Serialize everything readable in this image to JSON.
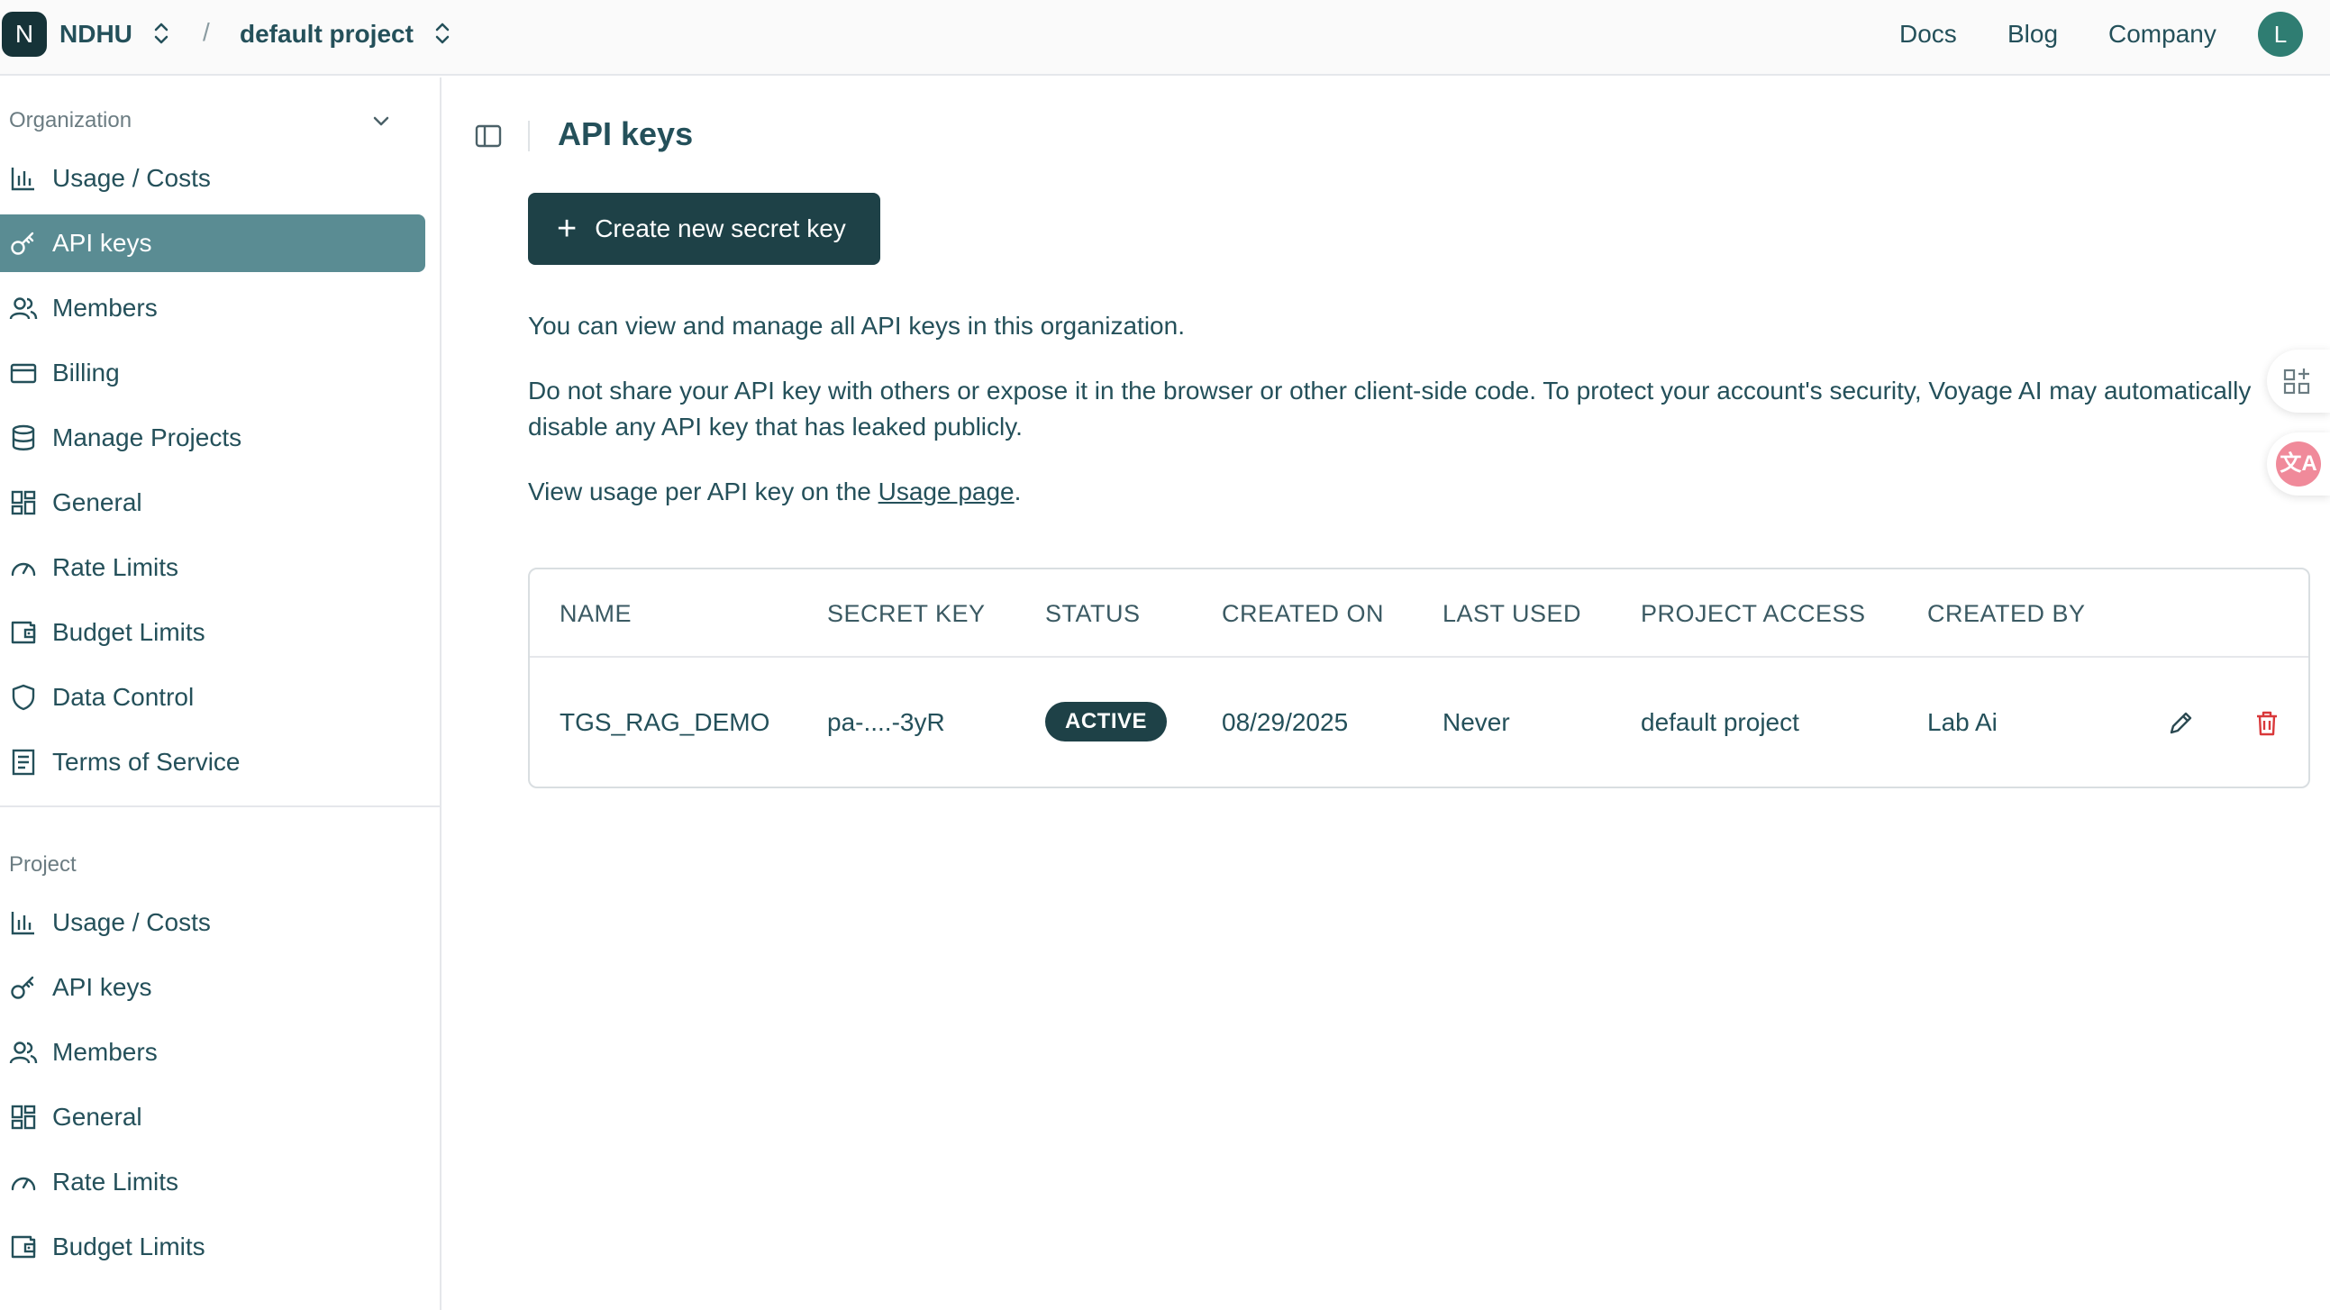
{
  "topbar": {
    "org_initial": "N",
    "org_name": "NDHU",
    "separator": "/",
    "project_name": "default project",
    "links": [
      "Docs",
      "Blog",
      "Company"
    ],
    "user_initial": "L"
  },
  "sidebar": {
    "organization_label": "Organization",
    "organization_items": [
      {
        "label": "Usage / Costs",
        "icon": "bar-chart-icon"
      },
      {
        "label": "API keys",
        "icon": "key-icon"
      },
      {
        "label": "Members",
        "icon": "users-icon"
      },
      {
        "label": "Billing",
        "icon": "credit-card-icon"
      },
      {
        "label": "Manage Projects",
        "icon": "database-icon"
      },
      {
        "label": "General",
        "icon": "grid-icon"
      },
      {
        "label": "Rate Limits",
        "icon": "gauge-icon"
      },
      {
        "label": "Budget Limits",
        "icon": "wallet-icon"
      },
      {
        "label": "Data Control",
        "icon": "shield-icon"
      },
      {
        "label": "Terms of Service",
        "icon": "document-icon"
      }
    ],
    "project_label": "Project",
    "project_items": [
      {
        "label": "Usage / Costs",
        "icon": "bar-chart-icon"
      },
      {
        "label": "API keys",
        "icon": "key-icon"
      },
      {
        "label": "Members",
        "icon": "users-icon"
      },
      {
        "label": "General",
        "icon": "grid-icon"
      },
      {
        "label": "Rate Limits",
        "icon": "gauge-icon"
      },
      {
        "label": "Budget Limits",
        "icon": "wallet-icon"
      }
    ]
  },
  "main": {
    "title": "API keys",
    "create_button": "Create new secret key",
    "intro": "You can view and manage all API keys in this organization.",
    "warning": "Do not share your API key with others or expose it in the browser or other client-side code. To protect your account's security, Voyage AI may automatically disable any API key that has leaked publicly.",
    "usage_prefix": "View usage per API key on the ",
    "usage_link": "Usage page",
    "usage_suffix": "."
  },
  "table": {
    "headers": [
      "NAME",
      "SECRET KEY",
      "STATUS",
      "CREATED ON",
      "LAST USED",
      "PROJECT ACCESS",
      "CREATED BY"
    ],
    "rows": [
      {
        "name": "TGS_RAG_DEMO",
        "secret_key": "pa-....-3yR",
        "status": "ACTIVE",
        "created_on": "08/29/2025",
        "last_used": "Never",
        "project_access": "default project",
        "created_by": "Lab Ai"
      }
    ]
  },
  "floating": {
    "translate_glyph": "文A"
  },
  "colors": {
    "accent_dark": "#1e4147",
    "sidebar_active": "#5a8c93",
    "text": "#24505a",
    "delete_red": "#d9383a"
  }
}
